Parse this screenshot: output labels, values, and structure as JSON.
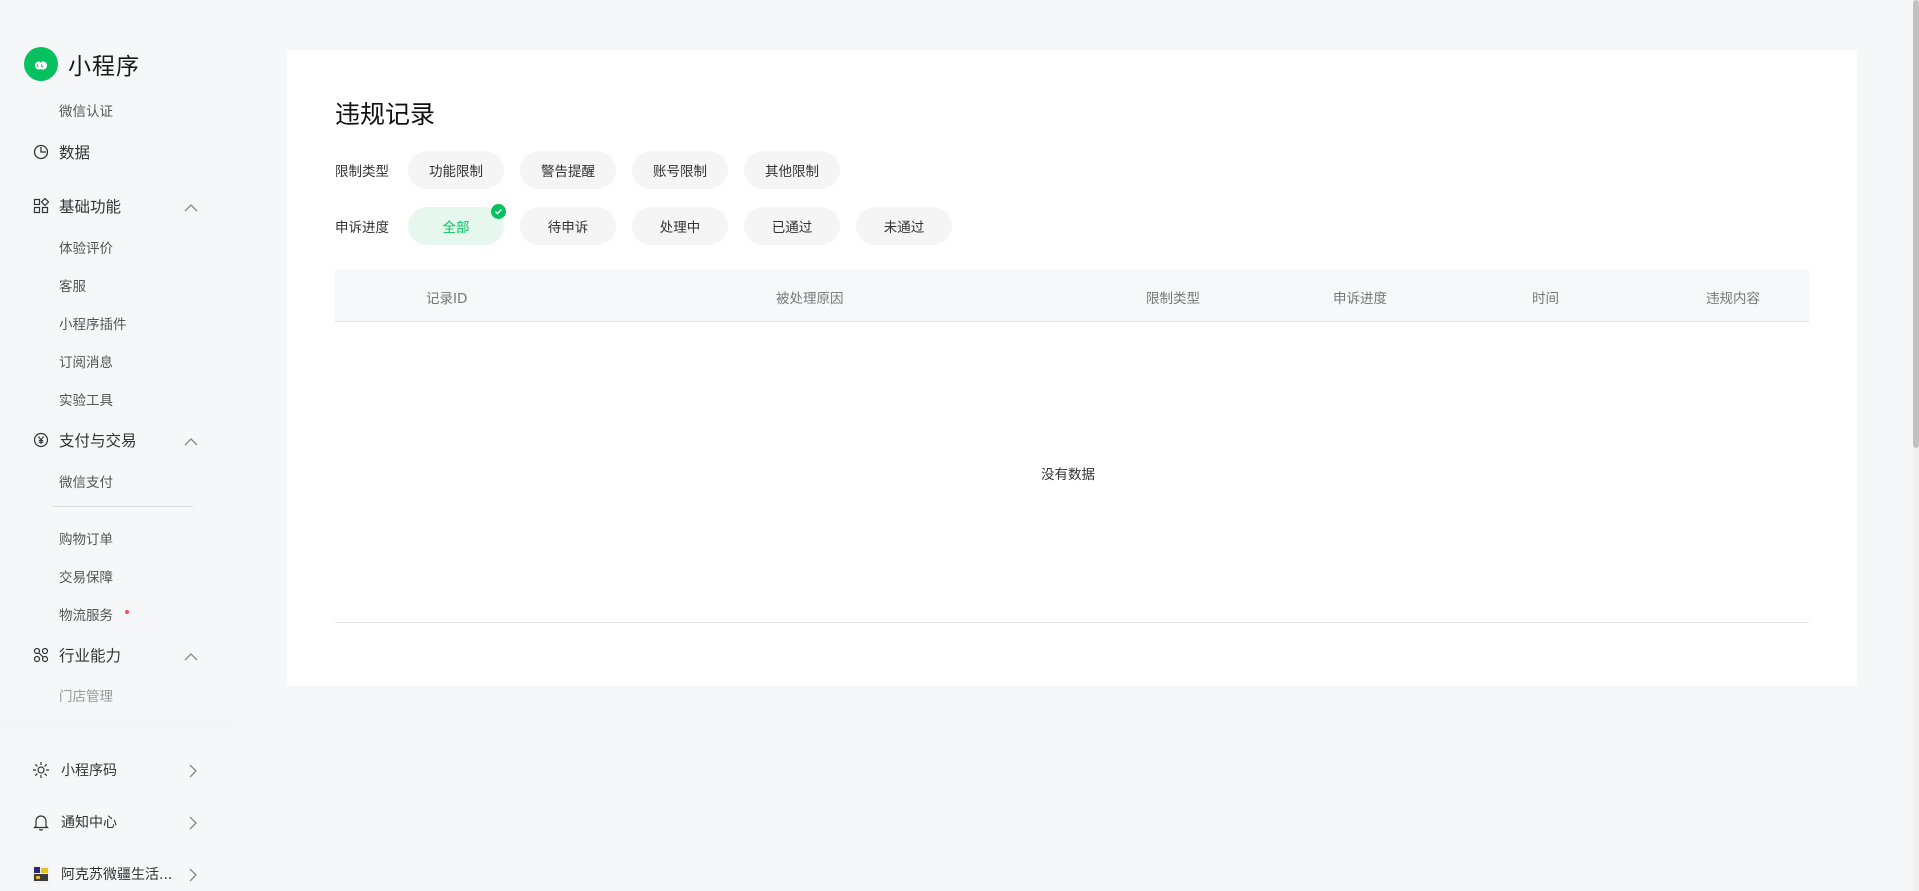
{
  "app": {
    "title": "小程序",
    "brand_color": "#07c160"
  },
  "sidebar": {
    "top_items": [
      {
        "label": "微信认证"
      }
    ],
    "groups": [
      {
        "label": "数据",
        "icon": "pie-chart-icon",
        "expandable": false
      },
      {
        "label": "基础功能",
        "icon": "grid-icon",
        "expanded": true,
        "items": [
          "体验评价",
          "客服",
          "小程序插件",
          "订阅消息",
          "实验工具"
        ]
      },
      {
        "label": "支付与交易",
        "icon": "yen-circle-icon",
        "expanded": true,
        "items": [
          "微信支付",
          "购物订单",
          "交易保障",
          "物流服务"
        ]
      },
      {
        "label": "行业能力",
        "icon": "industry-nodes-icon",
        "expanded": true,
        "items": [
          "门店管理"
        ]
      }
    ],
    "bottom": [
      {
        "label": "小程序码",
        "icon": "qrcode-sun-icon"
      },
      {
        "label": "通知中心",
        "icon": "bell-icon"
      },
      {
        "label": "阿克苏微疆生活...",
        "icon": "account-avatar-icon"
      }
    ]
  },
  "main": {
    "title": "违规记录",
    "filters": {
      "restriction": {
        "label": "限制类型",
        "options": [
          "功能限制",
          "警告提醒",
          "账号限制",
          "其他限制"
        ]
      },
      "appeal": {
        "label": "申诉进度",
        "options": [
          "全部",
          "待申诉",
          "处理中",
          "已通过",
          "未通过"
        ],
        "selected": "全部"
      }
    },
    "table": {
      "columns": [
        "记录ID",
        "被处理原因",
        "限制类型",
        "申诉进度",
        "时间",
        "违规内容"
      ],
      "empty_text": "没有数据"
    }
  }
}
